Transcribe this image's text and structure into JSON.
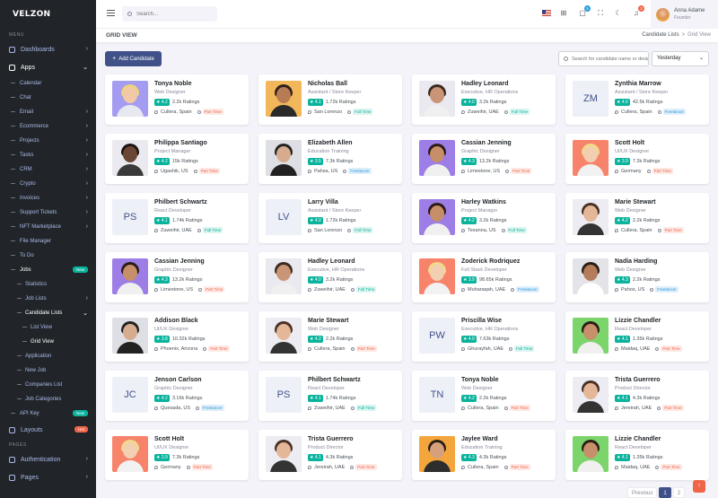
{
  "app": {
    "logo": "VELZON"
  },
  "sidebar": {
    "menu_title": "MENU",
    "pages_title": "PAGES",
    "dashboards": "Dashboards",
    "apps": "Apps",
    "calendar": "Calendar",
    "chat": "Chat",
    "email": "Email",
    "ecommerce": "Ecommerce",
    "projects": "Projects",
    "tasks": "Tasks",
    "crm": "CRM",
    "crypto": "Crypto",
    "invoices": "Invoices",
    "support_tickets": "Support Tickets",
    "nft_marketplace": "NFT Marketplace",
    "file_manager": "File Manager",
    "to_do": "To Do",
    "jobs": "Jobs",
    "statistics": "Statistics",
    "job_lists": "Job Lists",
    "candidate_lists": "Candidate Lists",
    "list_view": "List View",
    "grid_view": "Grid View",
    "application": "Application",
    "new_job": "New Job",
    "companies_list": "Companies List",
    "job_categories": "Job Categories",
    "api_key": "API Key",
    "layouts": "Layouts",
    "authentication": "Authentication",
    "pages": "Pages",
    "badge_new": "New",
    "badge_hot": "Hot"
  },
  "topbar": {
    "search_placeholder": "Search...",
    "cart_count": "5",
    "notif_count": "3",
    "user_name": "Anna Adame",
    "user_role": "Founder"
  },
  "page": {
    "title": "GRID VIEW",
    "crumb1": "Candidate Lists",
    "crumb_sep": ">",
    "crumb2": "Grid View",
    "add_button": "Add Candidate",
    "search_placeholder": "Search for candidate name or designation...",
    "sort_select": "Yesterday"
  },
  "candidates": [
    {
      "name": "Tonya Noble",
      "role": "Web Designer",
      "rating": "4.2",
      "ratings": "2.2k Ratings",
      "location": "Cullera, Spain",
      "type": "Part Time",
      "photo": "blonde"
    },
    {
      "name": "Nicholas Ball",
      "role": "Assistant / Store Keeper",
      "rating": "4.1",
      "ratings": "1.72k Ratings",
      "location": "San Lorenzo",
      "type": "Full Time",
      "photo": "curly"
    },
    {
      "name": "Hadley Leonard",
      "role": "Executive, HR Operations",
      "rating": "4.0",
      "ratings": "3.2k Ratings",
      "location": "Zuweihir, UAE",
      "type": "Full Time",
      "photo": "glasses"
    },
    {
      "name": "Zynthia Marrow",
      "role": "Assistant / Store Keeper",
      "rating": "4.0",
      "ratings": "42.5k Ratings",
      "location": "Cullera, Spain",
      "type": "Freelancer",
      "initials": "ZM"
    },
    {
      "name": "Philippa Santiago",
      "role": "Project Manager",
      "rating": "4.2",
      "ratings": "15k Ratings",
      "location": "Ugashik, US",
      "type": "Part Time",
      "photo": "dark"
    },
    {
      "name": "Elizabeth Allen",
      "role": "Education Training",
      "rating": "3.5",
      "ratings": "7.3k Ratings",
      "location": "Pahsa, US",
      "type": "Freelancer",
      "photo": "cap"
    },
    {
      "name": "Cassian Jenning",
      "role": "Graphic Designer",
      "rating": "4.3",
      "ratings": "13.2k Ratings",
      "location": "Limestone, US",
      "type": "Part Time",
      "photo": "purple"
    },
    {
      "name": "Scott Holt",
      "role": "UI/UX Designer",
      "rating": "3.9",
      "ratings": "7.3k Ratings",
      "location": "Germany",
      "type": "Part Time",
      "photo": "peach"
    },
    {
      "name": "Philbert Schwartz",
      "role": "React Developer",
      "rating": "4.1",
      "ratings": "1.74k Ratings",
      "location": "Zuweihir, UAE",
      "type": "Full Time",
      "initials": "PS"
    },
    {
      "name": "Larry Villa",
      "role": "Assistant / Store Keeper",
      "rating": "4.0",
      "ratings": "1.72k Ratings",
      "location": "San Lorenzo",
      "type": "Full Time",
      "initials": "LV"
    },
    {
      "name": "Harley Watkins",
      "role": "Project Manager",
      "rating": "4.2",
      "ratings": "3.2k Ratings",
      "location": "Texanna, US",
      "type": "Full Time",
      "photo": "purple"
    },
    {
      "name": "Marie Stewart",
      "role": "Web Designer",
      "rating": "4.2",
      "ratings": "2.2k Ratings",
      "location": "Cullera, Spain",
      "type": "Part Time",
      "photo": "glassesf"
    },
    {
      "name": "Cassian Jenning",
      "role": "Graphic Designer",
      "rating": "4.3",
      "ratings": "13.2k Ratings",
      "location": "Limestone, US",
      "type": "Part Time",
      "photo": "purple"
    },
    {
      "name": "Hadley Leonard",
      "role": "Executive, HR Operations",
      "rating": "4.0",
      "ratings": "3.2k Ratings",
      "location": "Zuweihir, UAE",
      "type": "Full Time",
      "photo": "glasses"
    },
    {
      "name": "Zoderick Rodriquez",
      "role": "Full Stack Developer",
      "rating": "3.9",
      "ratings": "98.65k Ratings",
      "location": "Muharaqah, UAE",
      "type": "Freelancer",
      "photo": "peach"
    },
    {
      "name": "Nadia Harding",
      "role": "Web Designer",
      "rating": "4.3",
      "ratings": "2.2k Ratings",
      "location": "Pahos, US",
      "type": "Freelancer",
      "photo": "beard"
    },
    {
      "name": "Addison Black",
      "role": "UI/UX Designer",
      "rating": "3.8",
      "ratings": "10.32k Ratings",
      "location": "Phoenix, Arizona",
      "type": "Part Time",
      "photo": "cap"
    },
    {
      "name": "Marie Stewart",
      "role": "Web Designer",
      "rating": "4.2",
      "ratings": "2.2k Ratings",
      "location": "Cullera, Spain",
      "type": "Part Time",
      "photo": "glassesf"
    },
    {
      "name": "Priscilla Wise",
      "role": "Executive, HR Operations",
      "rating": "4.0",
      "ratings": "7.63k Ratings",
      "location": "Ghurayfah, UAE",
      "type": "Full Time",
      "initials": "PW"
    },
    {
      "name": "Lizzie Chandler",
      "role": "React Developer",
      "rating": "4.1",
      "ratings": "1.35k Ratings",
      "location": "Maidaq, UAE",
      "type": "Part Time",
      "photo": "green"
    },
    {
      "name": "Jenson Carlson",
      "role": "Graphic Designer",
      "rating": "4.2",
      "ratings": "3.16k Ratings",
      "location": "Quesada, US",
      "type": "Freelancer",
      "initials": "JC"
    },
    {
      "name": "Philbert Schwartz",
      "role": "React Developer",
      "rating": "4.1",
      "ratings": "1.74k Ratings",
      "location": "Zuweihir, UAE",
      "type": "Full Time",
      "initials": "PS"
    },
    {
      "name": "Tonya Noble",
      "role": "Web Designer",
      "rating": "4.2",
      "ratings": "2.2k Ratings",
      "location": "Cullera, Spain",
      "type": "Part Time",
      "initials": "TN"
    },
    {
      "name": "Trista Guerrero",
      "role": "Product Director",
      "rating": "4.1",
      "ratings": "4.3k Ratings",
      "location": "Jereirah, UAE",
      "type": "Part Time",
      "photo": "glassesf"
    },
    {
      "name": "Scott Holt",
      "role": "UI/UX Designer",
      "rating": "3.9",
      "ratings": "7.3k Ratings",
      "location": "Germany",
      "type": "Part Time",
      "photo": "peach"
    },
    {
      "name": "Trista Guerrero",
      "role": "Product Director",
      "rating": "4.1",
      "ratings": "4.3k Ratings",
      "location": "Jereirah, UAE",
      "type": "Part Time",
      "photo": "glassesf"
    },
    {
      "name": "Jaylee Ward",
      "role": "Education Training",
      "rating": "4.3",
      "ratings": "4.3k Ratings",
      "location": "Cullera, Spain",
      "type": "Part Time",
      "photo": "orange"
    },
    {
      "name": "Lizzie Chandler",
      "role": "React Developer",
      "rating": "4.1",
      "ratings": "1.35k Ratings",
      "location": "Maidaq, UAE",
      "type": "Part Time",
      "photo": "green"
    }
  ],
  "colors": {
    "accent": "#405189",
    "rating": "#0ab39c",
    "part_time_bg": "#fde8e4",
    "part_time_fg": "#f06548",
    "full_time_bg": "#daf4f0",
    "full_time_fg": "#0ab39c",
    "freelancer_bg": "#dfeefa",
    "freelancer_fg": "#299cdb"
  },
  "pagination": {
    "previous": "Previous",
    "pages": [
      "1",
      "2"
    ],
    "next": "Next",
    "active": "1"
  }
}
